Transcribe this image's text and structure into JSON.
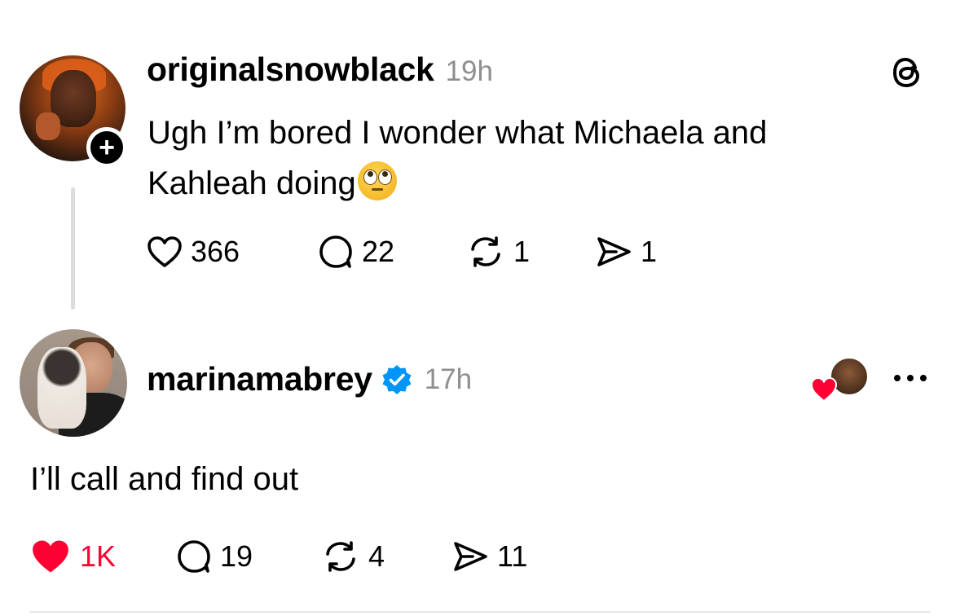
{
  "post1": {
    "username": "originalsnowblack",
    "time": "19h",
    "text": "Ugh I’m bored I wonder what Michaela and Kahleah doing",
    "emoji": "face-with-rolling-eyes",
    "follow_badge": "+",
    "likes": "366",
    "replies": "22",
    "reposts": "1",
    "shares": "1"
  },
  "post2": {
    "username": "marinamabrey",
    "verified": true,
    "time": "17h",
    "text": "I’ll call and find out",
    "likes": "1K",
    "liked": true,
    "replies": "19",
    "reposts": "4",
    "shares": "11"
  },
  "colors": {
    "liked_red": "#ff0033",
    "verified_blue": "#0095f6",
    "muted_gray": "#8e8e8e"
  },
  "icons": [
    "threads-logo-icon",
    "heart-icon",
    "comment-icon",
    "repost-icon",
    "share-icon",
    "verified-icon",
    "more-icon",
    "plus-icon"
  ]
}
